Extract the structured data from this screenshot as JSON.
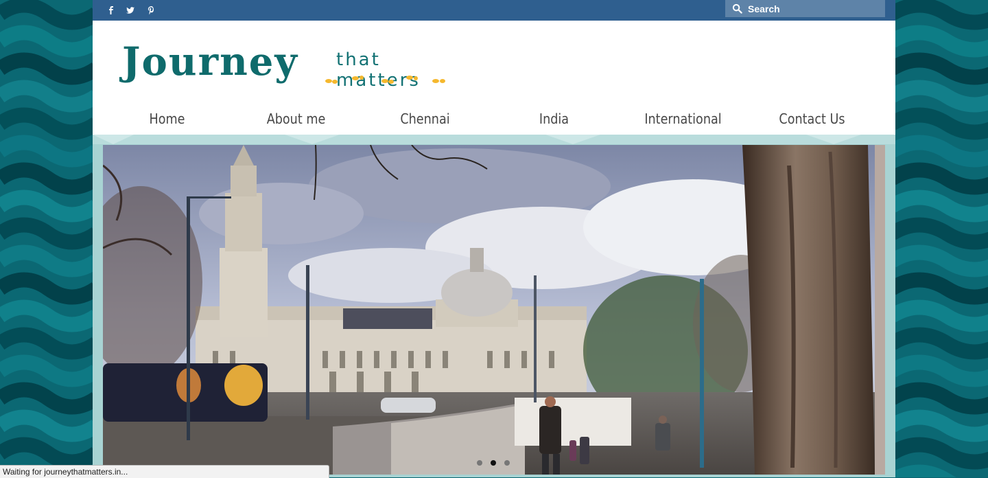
{
  "browser": {
    "status_text": "Waiting for journeythatmatters.in..."
  },
  "topbar": {
    "social": [
      {
        "icon": "facebook-icon"
      },
      {
        "icon": "twitter-icon"
      },
      {
        "icon": "pinterest-icon"
      }
    ],
    "search_placeholder": "Search"
  },
  "logo": {
    "main": "Journey",
    "sub": "that matters"
  },
  "nav": {
    "items": [
      "Home",
      "About me",
      "Chennai",
      "India",
      "International",
      "Contact Us"
    ]
  },
  "slider": {
    "slide_count": 3,
    "active_slide": 2
  },
  "colors": {
    "topbar": "#2f5f8f",
    "search_bg": "#5e83a8",
    "logo_teal": "#0f6b6c",
    "footprints": "#f5b82e",
    "band": "#a8d3d3",
    "background": "#0a6470"
  }
}
